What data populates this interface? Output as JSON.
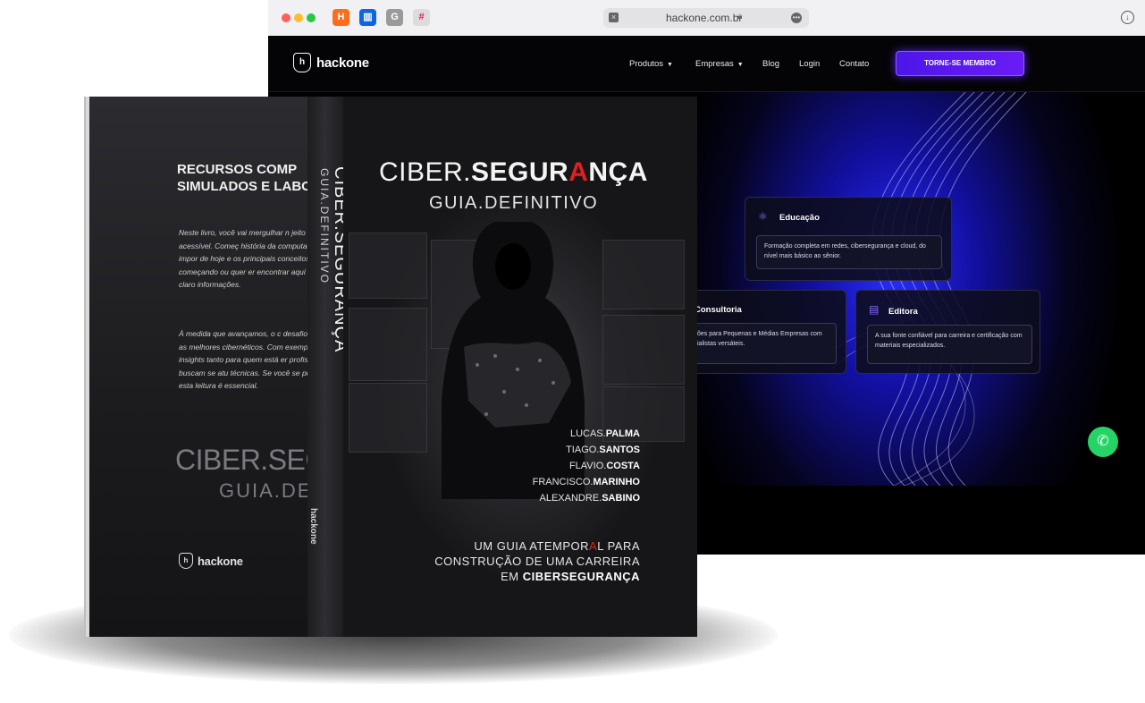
{
  "browser": {
    "url": "hackone.com.br",
    "tab_icons": [
      "hackernews-icon",
      "trello-icon",
      "grammarly-icon",
      "slack-icon"
    ]
  },
  "site": {
    "logo": "hackone",
    "nav": [
      {
        "label": "Produtos",
        "dropdown": true
      },
      {
        "label": "Empresas",
        "dropdown": true
      },
      {
        "label": "Blog",
        "dropdown": false
      },
      {
        "label": "Login",
        "dropdown": false
      },
      {
        "label": "Contato",
        "dropdown": false
      }
    ],
    "cta": "TORNE-SE MEMBRO",
    "cards": {
      "educacao": {
        "title": "Educação",
        "body": "Formação completa em redes, cibersegurança e cloud, do nível mais básico ao sênior."
      },
      "consultoria": {
        "title": "Consultoria",
        "body": "ões para Pequenas e Médias Empresas com ialistas versáteis."
      },
      "editora": {
        "title": "Editora",
        "body": "A sua fonte confiável para carreira e certificação com materiais especializados."
      }
    }
  },
  "book": {
    "back": {
      "heading_line1": "RECURSOS COMP",
      "heading_line2": "SIMULADOS E LABO",
      "para1": "Neste livro, você vai mergulhar n jeito prático e acessível. Começ história da computação, a impor de hoje e os principais conceitos você está começando ou quer er encontrar aqui um guia claro informações.",
      "para2": "À medida que avançamos, o c desafios atuais e as melhores cibernéticos. Com exemplos real insights tanto para quem está er profissionais que buscam se atu técnicas. Se você se preocupa con esta leitura é essencial.",
      "title1": "CIBER.SEG",
      "title2": "GUIA.DEF",
      "logo": "hackone"
    },
    "spine": {
      "title": "CIBER.SEGURANÇA",
      "subtitle": "GUIA.DEFINITIVO",
      "logo": "hackone"
    },
    "front": {
      "title_a": "CIBER.",
      "title_b": "SEGUR",
      "title_c": "A",
      "title_d": "NÇA",
      "subtitle": "GUIA.DEFINITIVO",
      "authors": [
        {
          "first": "LUCAS.",
          "last": "PALMA"
        },
        {
          "first": "TIAGO.",
          "last": "SANTOS"
        },
        {
          "first": "FLAVIO.",
          "last": "COSTA"
        },
        {
          "first": "FRANCISCO.",
          "last": "MARINHO"
        },
        {
          "first": "ALEXANDRE.",
          "last": "SABINO"
        }
      ],
      "tagline_1a": "UM GUIA ATEMPOR",
      "tagline_1b": "A",
      "tagline_1c": "L PARA",
      "tagline_2": "CONSTRUÇÃO DE UMA CARREIRA",
      "tagline_3a": "EM ",
      "tagline_3b": "CIBERSEGURANÇA"
    }
  },
  "colors": {
    "accent": "#5a1cf0",
    "whatsapp": "#25d366",
    "red": "#e02020"
  }
}
